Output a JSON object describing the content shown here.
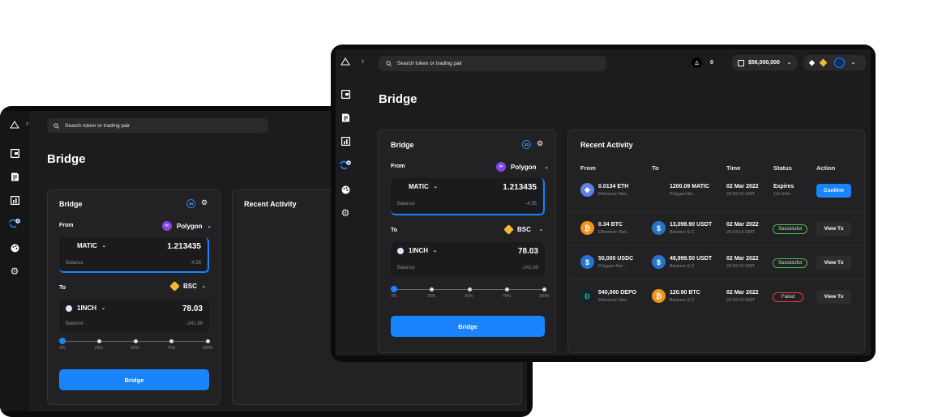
{
  "back": {
    "search_placeholder": "Search token or trading pair",
    "page_title": "Bridge",
    "card_title": "Bridge",
    "badge": "10",
    "from_label": "From",
    "from_chain": "Polygon",
    "from_token": "MATIC",
    "from_amount": "1.213435",
    "from_balance_label": "Balance",
    "from_balance": "-4.56",
    "to_label": "To",
    "to_chain": "BSC",
    "to_token": "1INCH",
    "to_amount": "78.03",
    "to_balance_label": "Balance",
    "to_balance": "-241.99",
    "ticks": [
      "0%",
      "25%",
      "50%",
      "75%",
      "100%"
    ],
    "slider_value_percent": 0,
    "bridge_button": "Bridge",
    "recent_title": "Recent Activity"
  },
  "front": {
    "search_placeholder": "Search token or trading pair",
    "notif_count": "0",
    "wallet_balance": "$56,000,000",
    "page_title": "Bridge",
    "card_title": "Bridge",
    "badge": "10",
    "from_label": "From",
    "from_chain": "Polygon",
    "from_token": "MATIC",
    "from_amount": "1.213435",
    "from_balance_label": "Balance",
    "from_balance": "-4.55",
    "to_label": "To",
    "to_chain": "BSC",
    "to_token": "1INCH",
    "to_amount": "78.03",
    "to_balance_label": "Balance",
    "to_balance": "-241.99",
    "ticks": [
      "0%",
      "25%",
      "50%",
      "75%",
      "100%"
    ],
    "slider_value_percent": 0,
    "bridge_button": "Bridge",
    "recent": {
      "title": "Recent Activity",
      "headers": {
        "from": "From",
        "to": "To",
        "time": "Time",
        "status": "Status",
        "action": "Action"
      },
      "rows": [
        {
          "from_amt": "0.0134 ETH",
          "from_net": "Ethereum Net...",
          "from_icon": "eth",
          "to_amt": "1200.09 MATIC",
          "to_net": "Polygon Ne...",
          "to_icon": "",
          "date": "02 Mar 2022",
          "time": "20:03:15 GMT",
          "status": "Expires",
          "status_sub": "11h 54m",
          "status_kind": "expires",
          "action": "Confirm"
        },
        {
          "from_amt": "0.34 BTC",
          "from_net": "Ethereum Net...",
          "from_icon": "btc",
          "to_amt": "13,098.90 USDT",
          "to_net": "Binance S.C",
          "to_icon": "usd",
          "date": "02 Mar 2022",
          "time": "20:03:15 GMT",
          "status": "Successful",
          "status_sub": "",
          "status_kind": "success",
          "action": "View Tx"
        },
        {
          "from_amt": "50,000 USDC",
          "from_net": "Polygon Net...",
          "from_icon": "usd",
          "to_amt": "49,999.50 USDT",
          "to_net": "Binance S.C",
          "to_icon": "usd",
          "date": "02 Mar 2022",
          "time": "20:03:15 GMT",
          "status": "Successful",
          "status_sub": "",
          "status_kind": "success",
          "action": "View Tx"
        },
        {
          "from_amt": "540,000 DEPO",
          "from_net": "Ethereum Net...",
          "from_icon": "depo",
          "to_amt": "120.90 BTC",
          "to_net": "Binance S.C",
          "to_icon": "btc",
          "date": "02 Mar 2022",
          "time": "20:03:15 GMT",
          "status": "Failed",
          "status_sub": "",
          "status_kind": "failed",
          "action": "View Tx"
        }
      ]
    }
  },
  "colors": {
    "accent": "#1a84ff",
    "success": "#3dbf4a",
    "failed": "#e23b3b",
    "polygon": "#8247e5",
    "bsc": "#f3ba2f",
    "eth": "#627eea",
    "btc": "#f7931a",
    "usd": "#2775ca",
    "depo": "#21c15a"
  },
  "sidebar_icons": [
    "wallet-icon",
    "document-icon",
    "chart-icon",
    "bridge-icon",
    "palette-icon",
    "gear-icon"
  ]
}
